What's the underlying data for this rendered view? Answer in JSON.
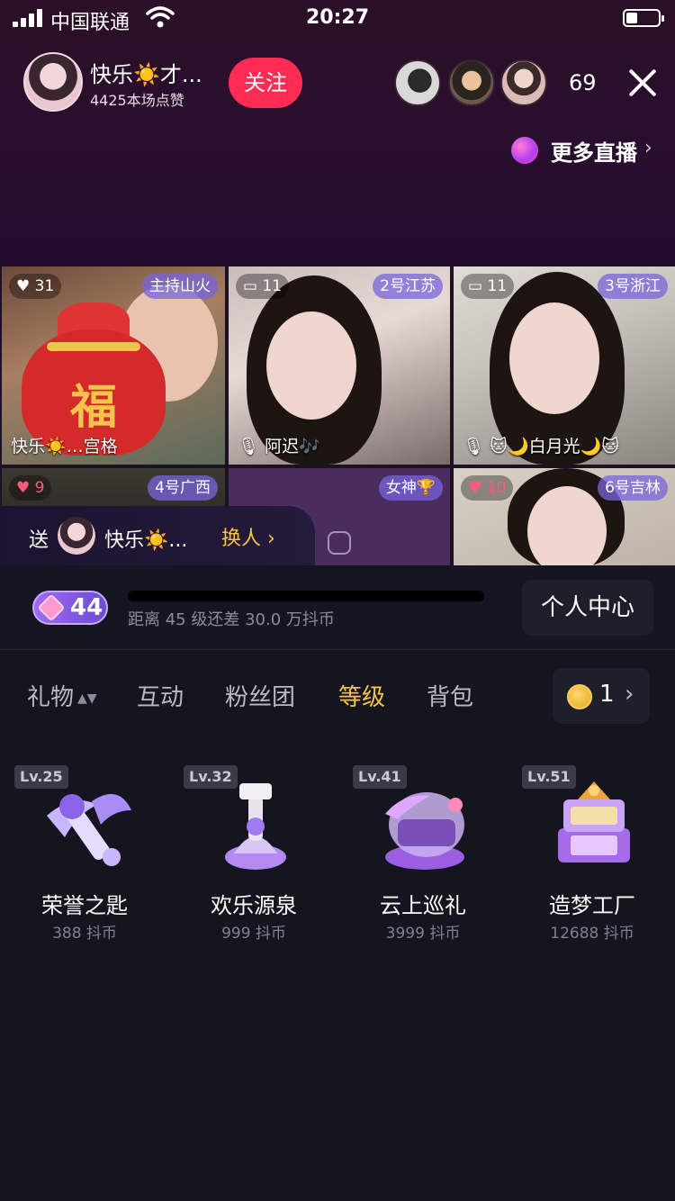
{
  "status_bar": {
    "carrier": "中国联通",
    "time": "20:27"
  },
  "host": {
    "name": "快乐☀️才...",
    "likes": "4425本场点赞",
    "follow_label": "关注"
  },
  "viewers": {
    "count": "69"
  },
  "more_live": {
    "label": "更多直播",
    "chevron": "›"
  },
  "seats": [
    {
      "tag": "主持山火",
      "badge": "♥ 31",
      "name": "快乐☀️…宫格"
    },
    {
      "tag": "2号江苏",
      "badge": "▭ 11",
      "name": "🎙 阿迟🎶"
    },
    {
      "tag": "3号浙江",
      "badge": "▭ 11",
      "name": "🎙 🐱🌙白月光🌙🐱"
    },
    {
      "tag": "4号广西",
      "badge": "♥ 9",
      "name": ""
    },
    {
      "tag": "女神🏆",
      "badge": "",
      "name": ""
    },
    {
      "tag": "6号吉林",
      "badge": "♥ 10",
      "name": ""
    }
  ],
  "lucky_bag": {
    "char": "福"
  },
  "send_to": {
    "label": "送",
    "name": "快乐☀️...",
    "switch_label": "换人 ›"
  },
  "level": {
    "badge": "44",
    "progress": 0.0,
    "hint": "距离 45 级还差 30.0 万抖币",
    "personal_center": "个人中心"
  },
  "tabs": [
    {
      "label": "礼物",
      "sort": "▲▼"
    },
    {
      "label": "互动"
    },
    {
      "label": "粉丝团"
    },
    {
      "label": "等级"
    },
    {
      "label": "背包"
    }
  ],
  "coins": {
    "count": "1",
    "chevron": "›"
  },
  "gifts": [
    {
      "level": "Lv.25",
      "name": "荣誉之匙",
      "price": "388 抖币"
    },
    {
      "level": "Lv.32",
      "name": "欢乐源泉",
      "price": "999 抖币"
    },
    {
      "level": "Lv.41",
      "name": "云上巡礼",
      "price": "3999 抖币"
    },
    {
      "level": "Lv.51",
      "name": "造梦工厂",
      "price": "12688 抖币"
    }
  ],
  "colors": {
    "accent_gold": "#f7c543",
    "follow_red": "#fe2c55",
    "seat_tag": "#7864dc"
  }
}
